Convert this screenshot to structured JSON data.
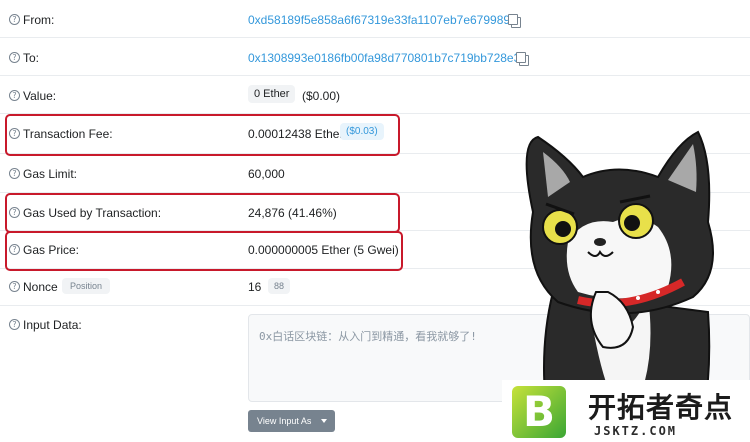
{
  "rows": {
    "from": {
      "label": "From:",
      "address": "0xd58189f5e858a6f67319e33fa1107eb7e679989f"
    },
    "to": {
      "label": "To:",
      "address": "0x1308993e0186fb00fa98d770801b7c719bb728e3"
    },
    "value": {
      "label": "Value:",
      "amount": "0 Ether",
      "usd": "($0.00)"
    },
    "fee": {
      "label": "Transaction Fee:",
      "amount": "0.00012438 Ether",
      "usd": "($0.03)"
    },
    "gas_limit": {
      "label": "Gas Limit:",
      "amount": "60,000"
    },
    "gas_used": {
      "label": "Gas Used by Transaction:",
      "amount": "24,876 (41.46%)"
    },
    "gas_price": {
      "label": "Gas Price:",
      "amount": "0.000000005 Ether (5 Gwei)"
    },
    "nonce": {
      "label": "Nonce",
      "position_badge": "Position",
      "amount": "16",
      "position": "88"
    },
    "input": {
      "label": "Input Data:",
      "text": "0x白话区块链：从入门到精通，看我就够了!",
      "button": "View Input As"
    }
  },
  "help_icon_glyph": "?",
  "watermark": {
    "brand_letter": "B",
    "brand_name": "开拓者奇点",
    "url": "JSKTZ.COM"
  },
  "colors": {
    "link": "#3498db",
    "highlight": "#c8192b",
    "usd_badge_bg": "#e8f4fc"
  }
}
